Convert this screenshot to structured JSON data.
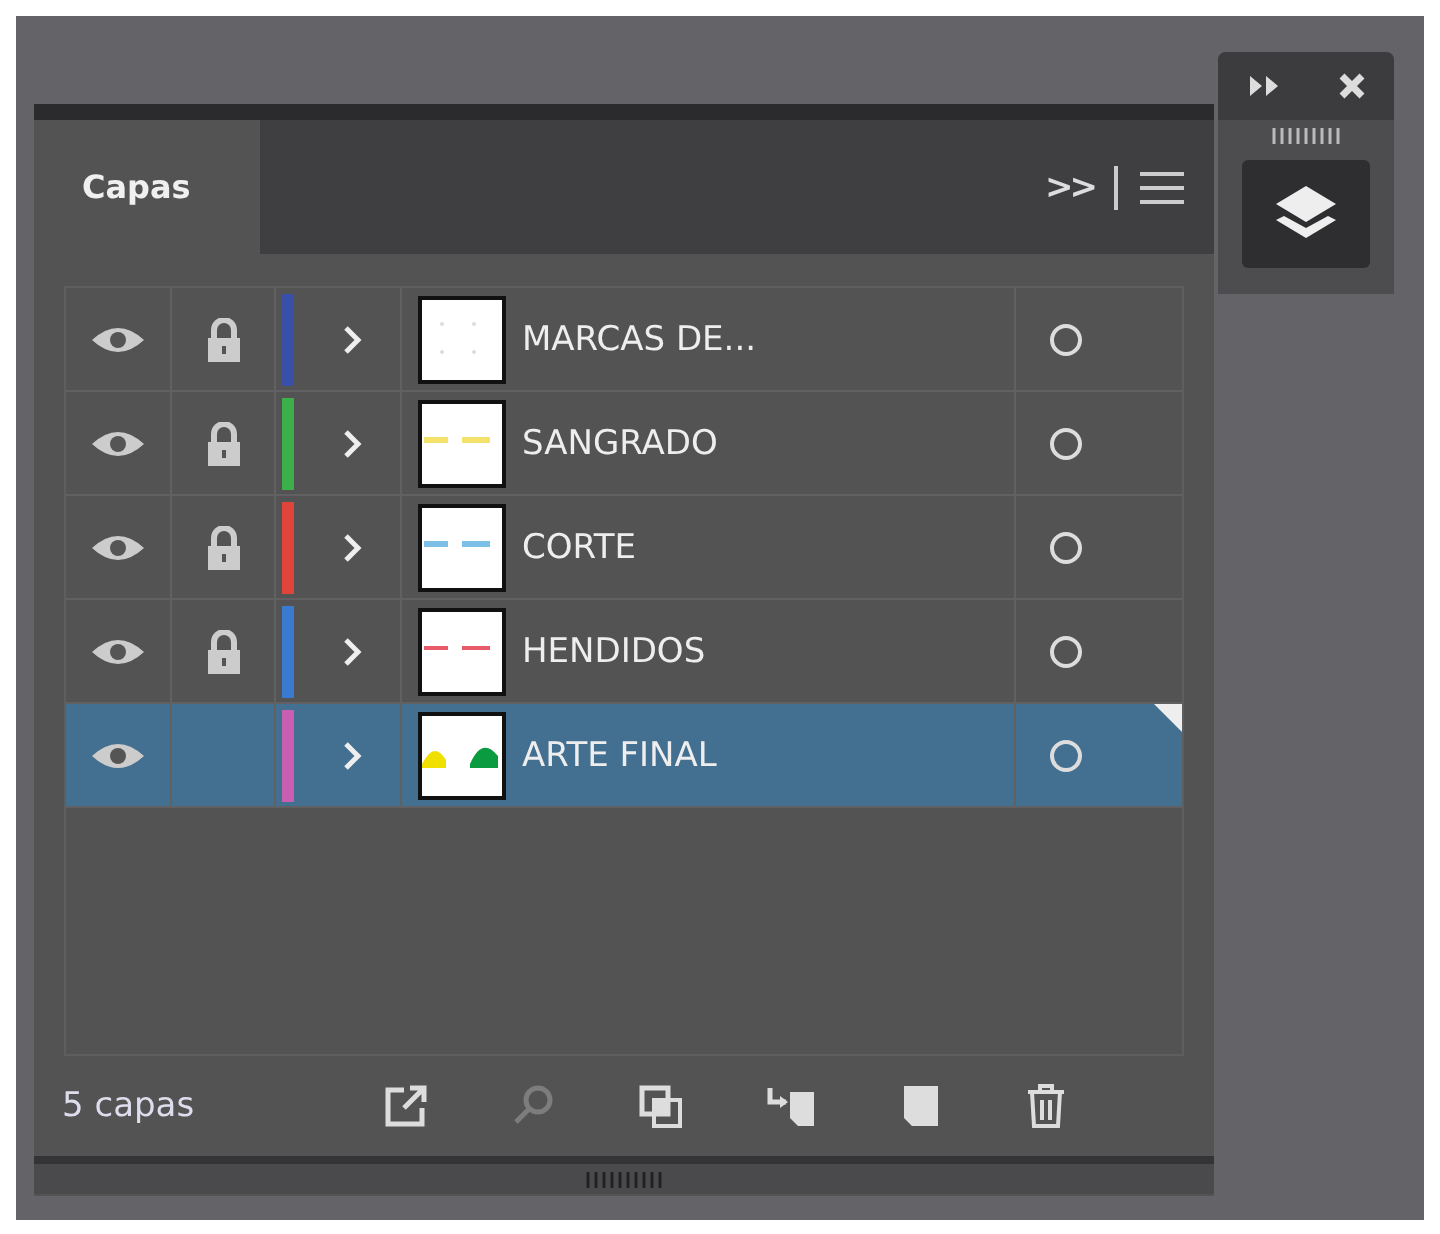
{
  "panel": {
    "tabs": [
      {
        "label": "Capas",
        "selected": true
      }
    ],
    "collapse_icon": ">>"
  },
  "layers": [
    {
      "name": "MARCAS DE...",
      "color": "#3a4fa8",
      "visible": true,
      "locked": true,
      "selected": false,
      "kind": "marks"
    },
    {
      "name": "SANGRADO",
      "color": "#3bb04a",
      "visible": true,
      "locked": true,
      "selected": false,
      "kind": "yellow"
    },
    {
      "name": "CORTE",
      "color": "#e0443a",
      "visible": true,
      "locked": true,
      "selected": false,
      "kind": "blue"
    },
    {
      "name": "HENDIDOS",
      "color": "#3a7ad0",
      "visible": true,
      "locked": true,
      "selected": false,
      "kind": "red"
    },
    {
      "name": "ARTE FINAL",
      "color": "#c85fb0",
      "visible": true,
      "locked": false,
      "selected": true,
      "kind": "art"
    }
  ],
  "status": "5 capas",
  "footer_tools": [
    {
      "kind": "export",
      "disabled": false
    },
    {
      "kind": "search",
      "disabled": true
    },
    {
      "kind": "clip",
      "disabled": false
    },
    {
      "kind": "sublayer",
      "disabled": false
    },
    {
      "kind": "newlayer",
      "disabled": false
    },
    {
      "kind": "trash",
      "disabled": false
    }
  ]
}
